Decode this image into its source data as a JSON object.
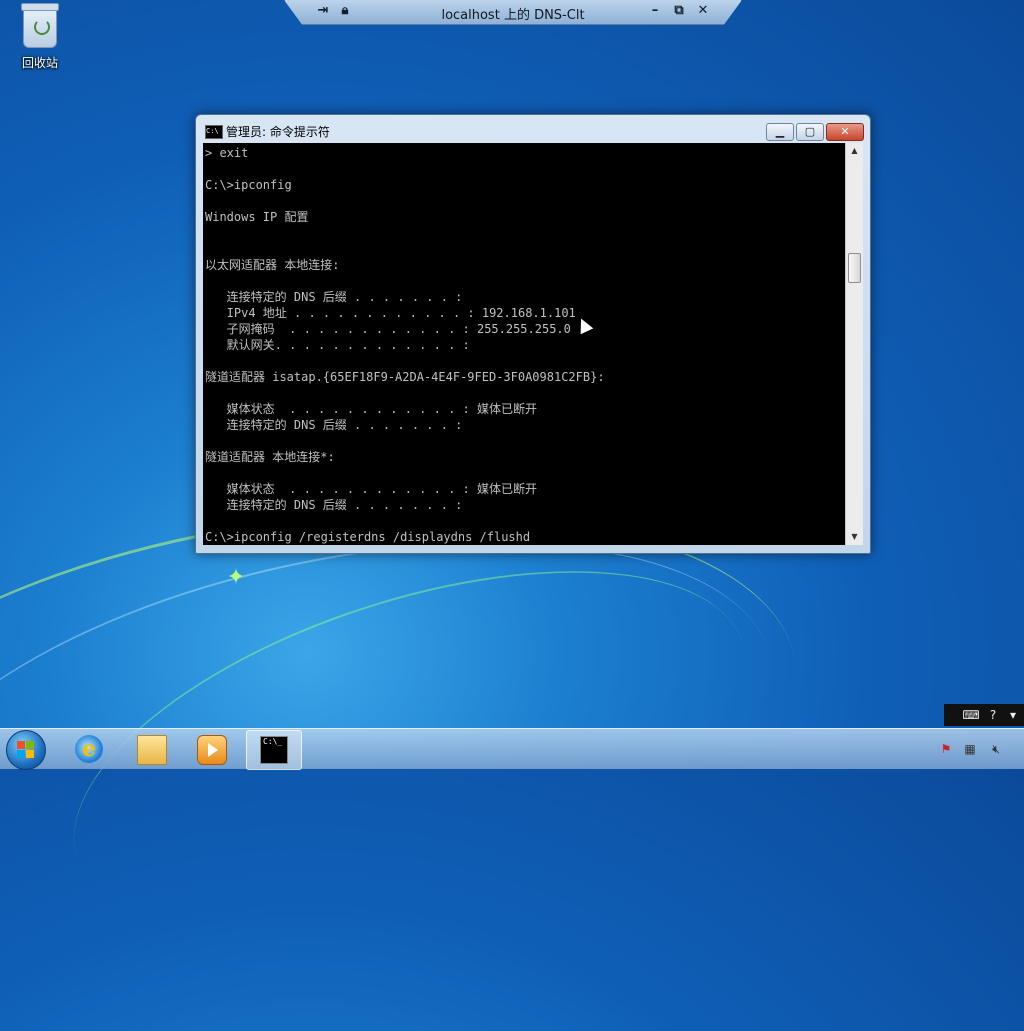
{
  "desktop": {
    "recycle_bin_label": "回收站"
  },
  "remote_bar": {
    "title": "localhost 上的 DNS-Clt",
    "icons": [
      "pin-icon",
      "lock-icon",
      "minimize-icon",
      "restore-icon",
      "close-icon"
    ]
  },
  "cmd_window": {
    "title": "管理员: 命令提示符",
    "icon_text": "C:\\",
    "lines": [
      "> exit",
      "",
      "C:\\>ipconfig",
      "",
      "Windows IP 配置",
      "",
      "",
      "以太网适配器 本地连接:",
      "",
      "   连接特定的 DNS 后缀 . . . . . . . :",
      "   IPv4 地址 . . . . . . . . . . . . : 192.168.1.101",
      "   子网掩码  . . . . . . . . . . . . : 255.255.255.0",
      "   默认网关. . . . . . . . . . . . . :",
      "",
      "隧道适配器 isatap.{65EF18F9-A2DA-4E4F-9FED-3F0A0981C2FB}:",
      "",
      "   媒体状态  . . . . . . . . . . . . : 媒体已断开",
      "   连接特定的 DNS 后缀 . . . . . . . :",
      "",
      "隧道适配器 本地连接*:",
      "",
      "   媒体状态  . . . . . . . . . . . . : 媒体已断开",
      "   连接特定的 DNS 后缀 . . . . . . . :",
      "",
      "C:\\>ipconfig /registerdns /displaydns /flushd"
    ]
  },
  "session_bar": {
    "icons": [
      "keyboard-icon",
      "help-icon",
      "dropdown-icon"
    ]
  },
  "taskbar": {
    "start_label": "",
    "pinned": [
      {
        "name": "ie-icon",
        "glyph": "e"
      },
      {
        "name": "explorer-folder-icon",
        "glyph": ""
      },
      {
        "name": "media-player-icon",
        "glyph": ""
      },
      {
        "name": "cmd-taskbar-icon",
        "glyph": "C:\\_"
      }
    ],
    "tray_icons": [
      "action-center-flag-icon",
      "network-icon",
      "volume-muted-icon"
    ]
  },
  "colors": {
    "console_bg": "#000000",
    "console_text": "#c0c0c0",
    "close_button": "#c7452c"
  }
}
